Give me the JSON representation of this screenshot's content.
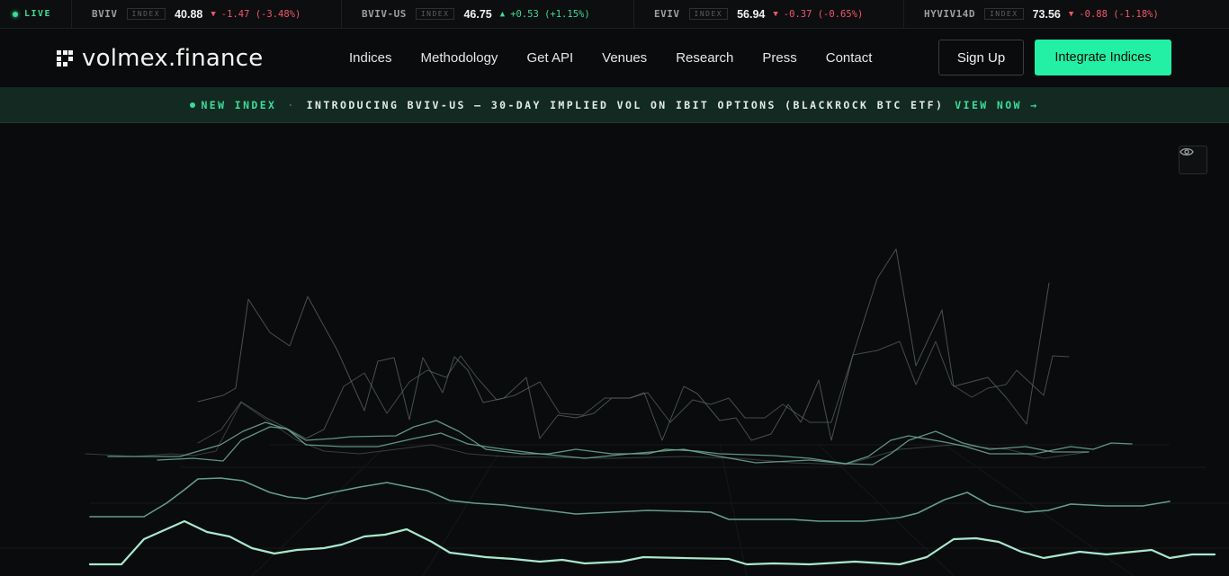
{
  "ticker": {
    "live_label": "LIVE",
    "items": [
      {
        "symbol": "BVIV",
        "badge": "INDEX",
        "value": "40.88",
        "direction": "down",
        "arrow": "▼",
        "change": "-1.47 (-3.48%)"
      },
      {
        "symbol": "BVIV-US",
        "badge": "INDEX",
        "value": "46.75",
        "direction": "up",
        "arrow": "▲",
        "change": "+0.53 (+1.15%)"
      },
      {
        "symbol": "EVIV",
        "badge": "INDEX",
        "value": "56.94",
        "direction": "down",
        "arrow": "▼",
        "change": "-0.37 (-0.65%)"
      },
      {
        "symbol": "HYVIV14D",
        "badge": "INDEX",
        "value": "73.56",
        "direction": "down",
        "arrow": "▼",
        "change": "-0.88 (-1.18%)"
      }
    ]
  },
  "nav": {
    "logo_text": "volmex.finance",
    "menu": [
      "Indices",
      "Methodology",
      "Get API",
      "Venues",
      "Research",
      "Press",
      "Contact"
    ],
    "signup_label": "Sign Up",
    "integrate_label": "Integrate Indices"
  },
  "announcement": {
    "tag": "NEW INDEX",
    "separator": "·",
    "message": "INTRODUCING BVIV-US — 30-DAY IMPLIED VOL ON IBIT OPTIONS (BLACKROCK BTC ETF)",
    "link": "VIEW NOW →"
  },
  "hero": {
    "toggle_icon": "eye-icon",
    "colors": {
      "accent": "#23f0a4",
      "line_front": "#a8e8cd",
      "line_mid": "#6fae95",
      "line_back": "#5d6a66"
    }
  }
}
